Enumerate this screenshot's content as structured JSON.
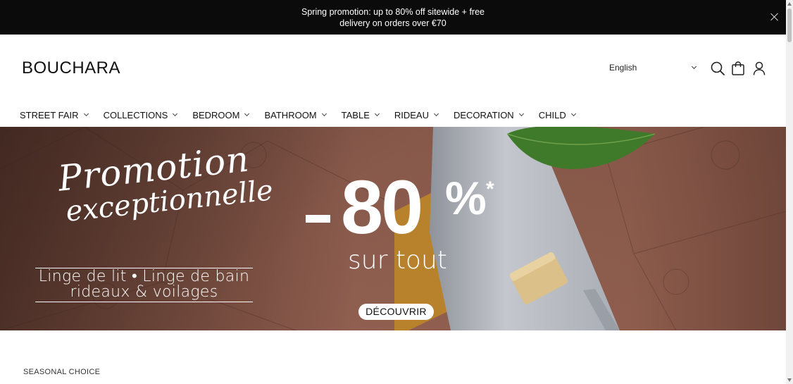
{
  "promo": {
    "line1": "Spring promotion: up to 80% off sitewide + free",
    "line2": "delivery on orders over €70",
    "close_icon": "close-icon"
  },
  "header": {
    "logo": "BOUCHARA",
    "language": "English",
    "icons": [
      "search-icon",
      "bag-icon",
      "account-icon"
    ]
  },
  "nav": {
    "items": [
      {
        "label": "STREET FAIR"
      },
      {
        "label": "COLLECTIONS"
      },
      {
        "label": "BEDROOM"
      },
      {
        "label": "BATHROOM"
      },
      {
        "label": "TABLE"
      },
      {
        "label": "RIDEAU"
      },
      {
        "label": "DECORATION"
      },
      {
        "label": "CHILD"
      }
    ]
  },
  "hero": {
    "script_line1": "Promotion",
    "script_line2": "exceptionnelle",
    "sub_line1": "Linge de lit • Linge de bain",
    "sub_line2": "rideaux & voilages",
    "big_number": "80",
    "percent": "%",
    "asterisk": "*",
    "sur_tout": "sur tout",
    "button": "DÉCOUVRIR"
  },
  "section": {
    "label": "SEASONAL CHOICE"
  },
  "colors": {
    "promo_bg": "#0b0b0b",
    "hero_terracotta": "#8a5b4b",
    "towel": "#b9bcc2",
    "leaf": "#3f7a2a"
  }
}
